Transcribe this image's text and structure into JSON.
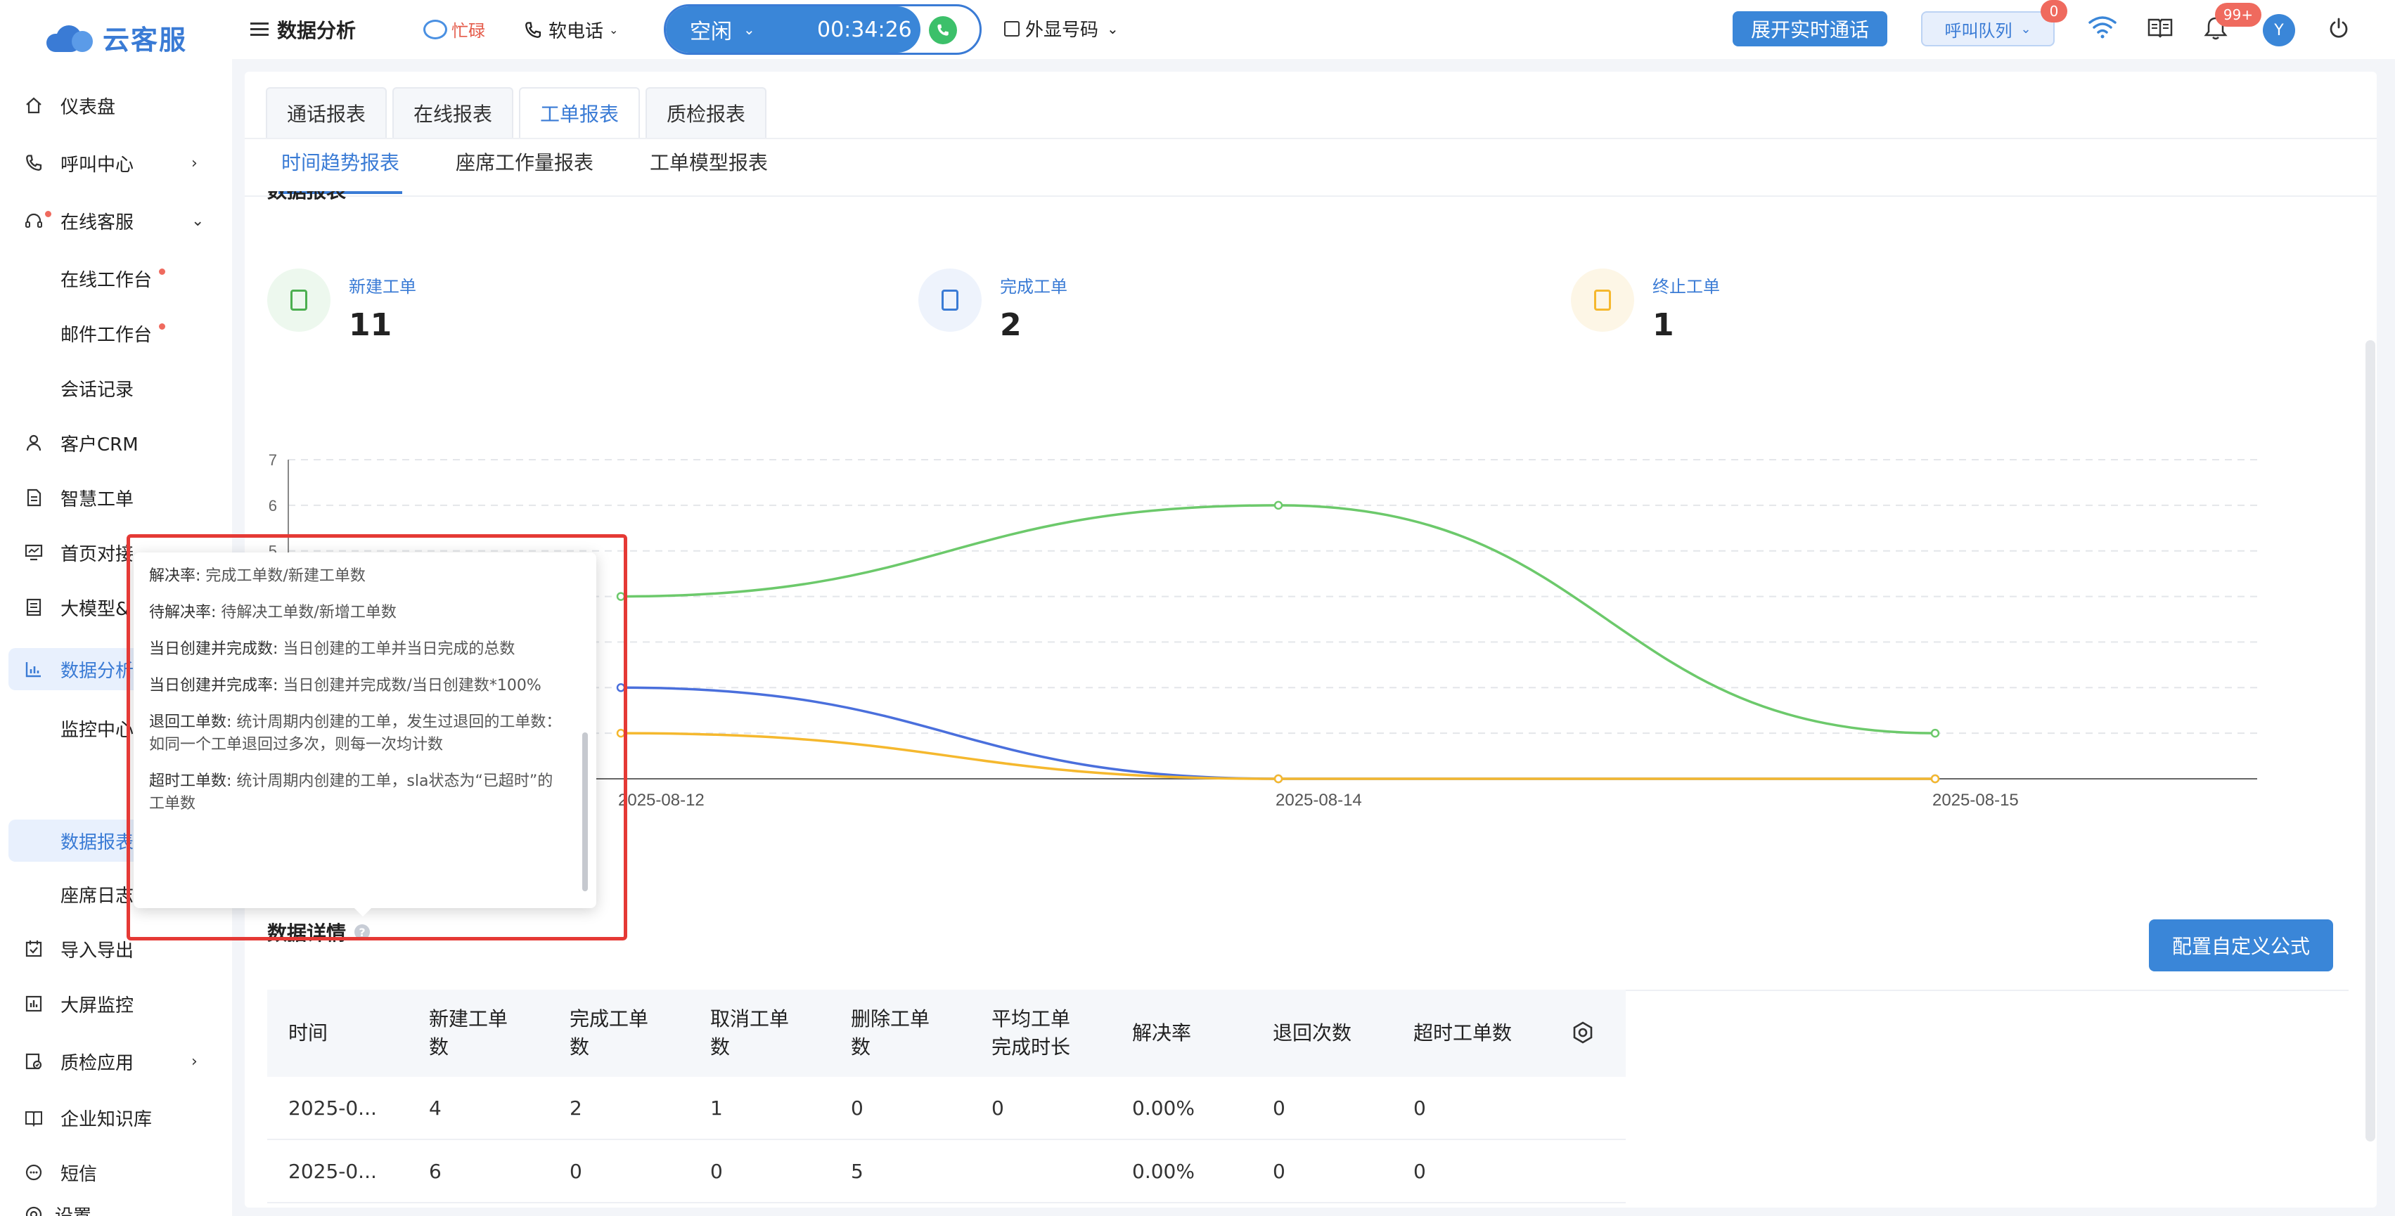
{
  "app": {
    "logo_text": "云客服",
    "section_title": "数据分析"
  },
  "topbar": {
    "status_busy": "忙碌",
    "softphone": "软电话",
    "call_status": "空闲",
    "timer": "00:34:26",
    "external_number": "外显号码",
    "realtime_button": "展开实时通话",
    "queue_button": "呼叫队列",
    "queue_badge": "0",
    "notification_badge": "99+",
    "avatar_letter": "Y"
  },
  "sidebar": {
    "items": [
      {
        "label": "仪表盘",
        "icon": "home-icon"
      },
      {
        "label": "呼叫中心",
        "icon": "phone-icon"
      },
      {
        "label": "在线客服",
        "icon": "headset-icon"
      },
      {
        "label": "在线工作台"
      },
      {
        "label": "邮件工作台"
      },
      {
        "label": "会话记录"
      },
      {
        "label": "客户CRM",
        "icon": "user-icon"
      },
      {
        "label": "智慧工单",
        "icon": "document-icon"
      },
      {
        "label": "首页对接",
        "icon": "monitor-icon"
      },
      {
        "label": "大模型&",
        "icon": "book-icon"
      },
      {
        "label": "数据分析",
        "icon": "chart-icon"
      },
      {
        "label": "监控中心"
      },
      {
        "label": "数据报表"
      },
      {
        "label": "座席日志"
      },
      {
        "label": "导入导出",
        "icon": "calendar-check-icon"
      },
      {
        "label": "大屏监控",
        "icon": "bar-chart-icon"
      },
      {
        "label": "质检应用",
        "icon": "quality-icon"
      },
      {
        "label": "企业知识库",
        "icon": "knowledge-icon"
      },
      {
        "label": "短信",
        "icon": "sms-icon"
      },
      {
        "label": "设置",
        "icon": "settings-icon"
      }
    ]
  },
  "tabs": [
    "通话报表",
    "在线报表",
    "工单报表",
    "质检报表"
  ],
  "subtabs": [
    "时间趋势报表",
    "座席工作量报表",
    "工单模型报表"
  ],
  "section": {
    "title": "数据报表"
  },
  "stats": [
    {
      "label": "新建工单",
      "value": "11",
      "color": "#4caf50"
    },
    {
      "label": "完成工单",
      "value": "2",
      "color": "#3a7bd5"
    },
    {
      "label": "终止工单",
      "value": "1",
      "color": "#f5b82e"
    }
  ],
  "chart_data": {
    "type": "line",
    "categories": [
      "2025-08-12",
      "2025-08-14",
      "2025-08-15"
    ],
    "ylim": [
      0,
      7
    ],
    "yticks": [
      "7",
      "6",
      "5"
    ],
    "series": [
      {
        "values": [
          4,
          6,
          1
        ],
        "color": "#6cc96b"
      },
      {
        "values": [
          2,
          0,
          0
        ],
        "color": "#4a6fdc"
      },
      {
        "values": [
          1,
          0,
          0
        ],
        "color": "#f5b82e"
      }
    ]
  },
  "tooltip": {
    "items": [
      {
        "term": "解决率:",
        "desc": "完成工单数/新建工单数"
      },
      {
        "term": "待解决率:",
        "desc": "待解决工单数/新增工单数"
      },
      {
        "term": "当日创建并完成数:",
        "desc": "当日创建的工单并当日完成的总数"
      },
      {
        "term": "当日创建并完成率:",
        "desc": "当日创建并完成数/当日创建数*100%"
      },
      {
        "term": "退回工单数:",
        "desc": "统计周期内创建的工单，发生过退回的工单数：如同一个工单退回过多次，则每一次均计数"
      },
      {
        "term": "超时工单数:",
        "desc": "统计周期内创建的工单，sla状态为“已超时”的工单数"
      }
    ]
  },
  "detail": {
    "title": "数据详情",
    "config_button": "配置自定义公式",
    "columns": [
      "时间",
      "新建工单数",
      "完成工单数",
      "取消工单数",
      "删除工单数",
      "平均工单完成时长",
      "解决率",
      "退回次数",
      "超时工单数"
    ],
    "rows": [
      [
        "2025-0...",
        "4",
        "2",
        "1",
        "0",
        "0",
        "0.00%",
        "0",
        "0"
      ],
      [
        "2025-0...",
        "6",
        "0",
        "0",
        "5",
        "",
        "0.00%",
        "0",
        "0"
      ]
    ]
  }
}
